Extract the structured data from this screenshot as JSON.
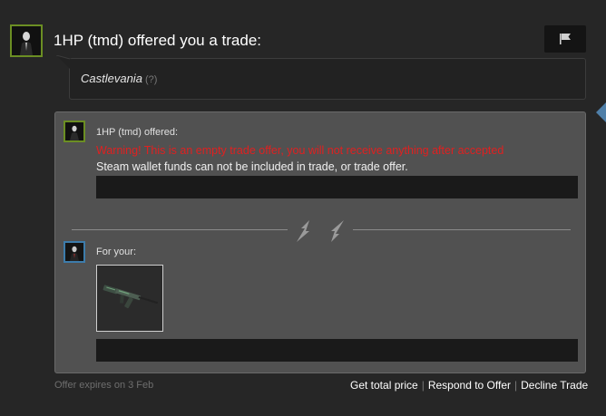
{
  "offer": {
    "title": "1HP (tmd) offered you a trade:",
    "message": "Castlevania",
    "message_help": "(?)"
  },
  "trade": {
    "their_label": "1HP (tmd) offered:",
    "warning": "Warning! This is an empty trade offer, you will not receive anything after accepted",
    "note": "Steam wallet funds can not be included in trade, or trade offer.",
    "your_label": "For your:",
    "your_item_icon": "ak47-rifle-icon"
  },
  "footer": {
    "expires": "Offer expires on 3 Feb",
    "get_total_price": "Get total price",
    "separator": "|",
    "respond": "Respond to Offer",
    "decline": "Decline Trade"
  },
  "colors": {
    "background": "#262626",
    "panel": "#515151",
    "warning": "#e02020",
    "online_border": "#6b8e23",
    "friend_border": "#3d7cab"
  }
}
